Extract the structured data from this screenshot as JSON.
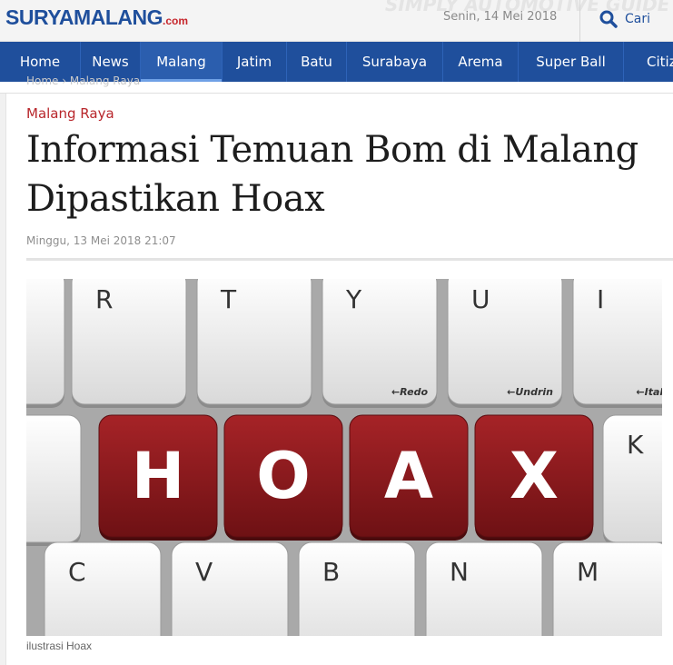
{
  "header": {
    "logo_main": "SURYAMALANG",
    "logo_suffix": ".com",
    "ghost_text": "SIMPLY AUTOMOTIVE GUIDE",
    "date": "Senin, 14 Mei 2018",
    "search_label": "Cari"
  },
  "nav": {
    "items": [
      {
        "label": "Home"
      },
      {
        "label": "News"
      },
      {
        "label": "Malang"
      },
      {
        "label": "Jatim"
      },
      {
        "label": "Batu"
      },
      {
        "label": "Surabaya"
      },
      {
        "label": "Arema"
      },
      {
        "label": "Super Ball"
      },
      {
        "label": "Citiz"
      }
    ],
    "active": "Malang",
    "breadcrumb": "Home  ›  Malang Raya"
  },
  "article": {
    "category": "Malang Raya",
    "title": "Informasi Temuan Bom di Malang Dipastikan Hoax",
    "published": "Minggu, 13 Mei 2018 21:07",
    "image": {
      "top_row_keys": [
        "R",
        "T",
        "Y",
        "U",
        "I"
      ],
      "top_row_sublabels": [
        "",
        "",
        "←Redo",
        "←Undrin",
        "←Italics"
      ],
      "hoax_keys": [
        "H",
        "O",
        "A",
        "X"
      ],
      "right_key": "K",
      "bottom_row_keys": [
        "C",
        "V",
        "B",
        "N",
        "M"
      ],
      "hoax_key_color": "#8f1c1f",
      "key_color": "#f2f2f2"
    },
    "caption": "ilustrasi Hoax"
  },
  "colors": {
    "brand_blue": "#1f4f9c",
    "brand_red": "#b8262b"
  }
}
